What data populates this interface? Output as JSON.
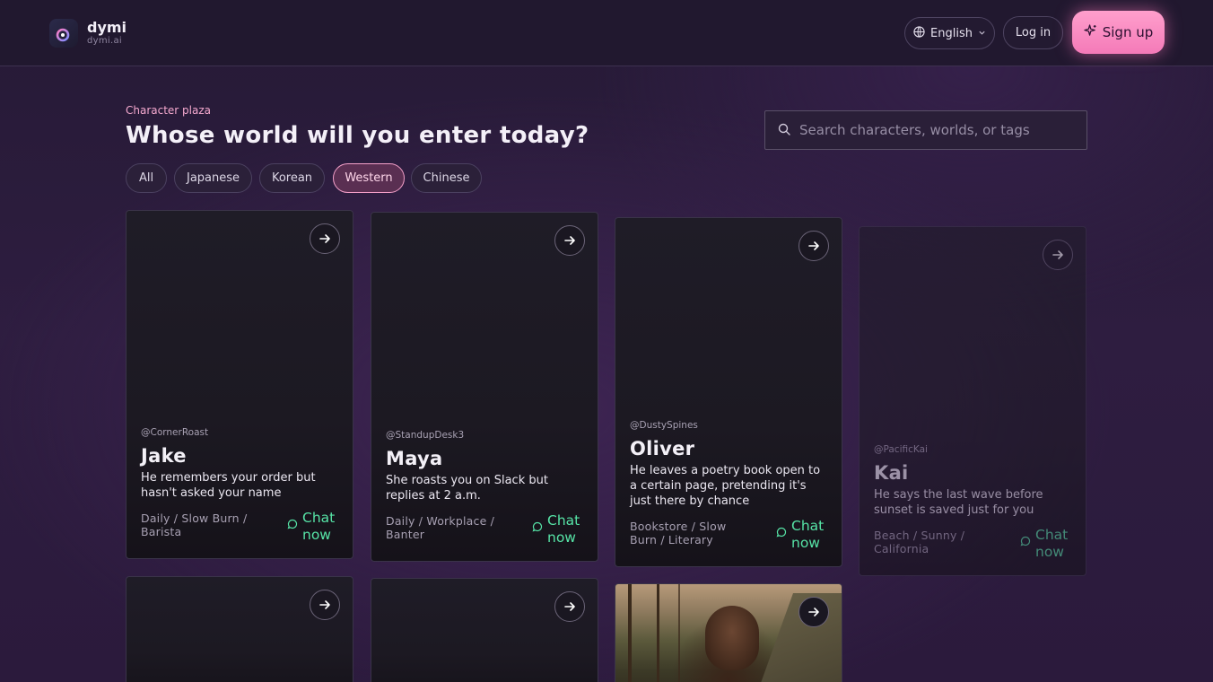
{
  "brand": {
    "name": "dymi",
    "domain": "dymi.ai"
  },
  "header": {
    "language": "English",
    "login": "Log in",
    "signup": "Sign up"
  },
  "hero": {
    "eyebrow": "Character plaza",
    "title": "Whose world will you enter today?",
    "search_placeholder": "Search characters, worlds, or tags"
  },
  "filters": [
    {
      "label": "All",
      "active": false
    },
    {
      "label": "Japanese",
      "active": false
    },
    {
      "label": "Korean",
      "active": false
    },
    {
      "label": "Western",
      "active": true
    },
    {
      "label": "Chinese",
      "active": false
    }
  ],
  "cards": [
    {
      "handle": "@CornerRoast",
      "name": "Jake",
      "desc": "He remembers your order but hasn't asked your name",
      "tags": "Daily / Slow Burn / Barista",
      "cta": "Chat now"
    },
    {
      "handle": "@StandupDesk3",
      "name": "Maya",
      "desc": "She roasts you on Slack but replies at 2 a.m.",
      "tags": "Daily / Workplace / Banter",
      "cta": "Chat now"
    },
    {
      "handle": "@DustySpines",
      "name": "Oliver",
      "desc": "He leaves a poetry book open to a certain page, pretending it's just there by chance",
      "tags": "Bookstore / Slow Burn / Literary",
      "cta": "Chat now"
    },
    {
      "handle": "@PacificKai",
      "name": "Kai",
      "desc": "He says the last wave before sunset is saved just for you",
      "tags": "Beach / Sunny / California",
      "cta": "Chat now"
    }
  ],
  "colors": {
    "accent_pink": "#f47ab8",
    "chat_green": "#56e3a6",
    "background": "#2a1c3a"
  }
}
